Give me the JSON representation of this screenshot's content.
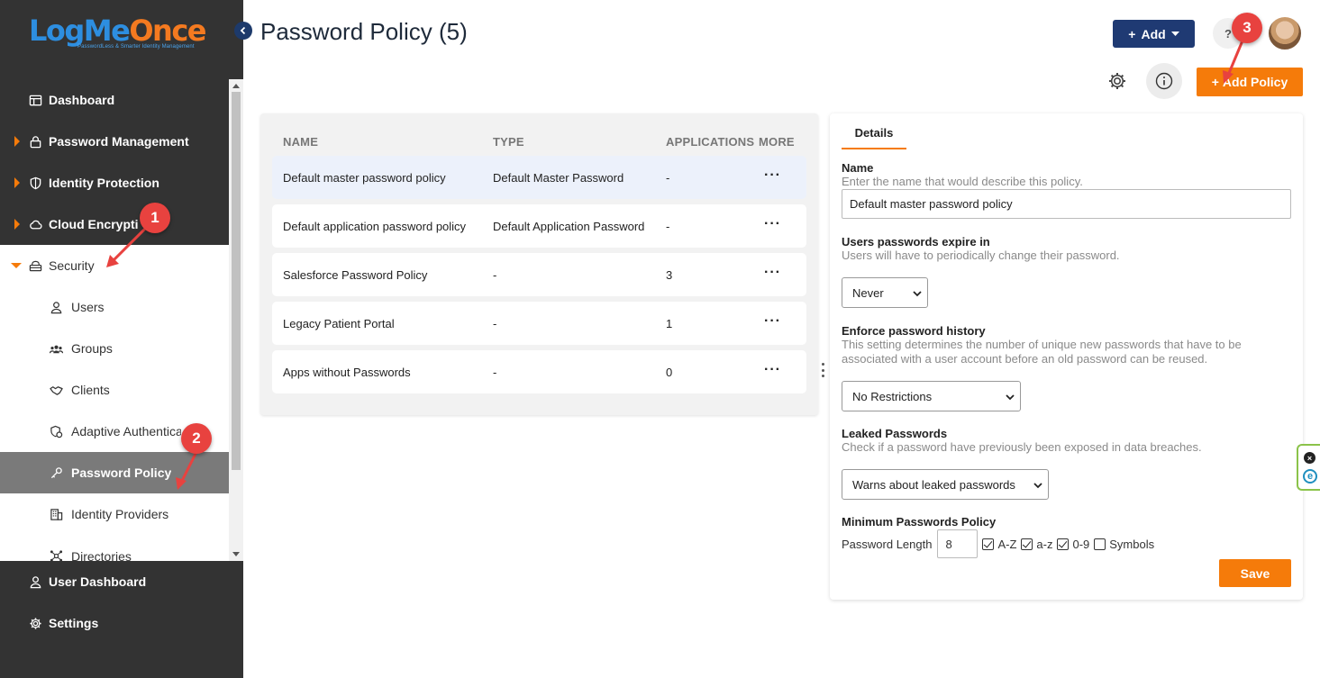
{
  "logo": {
    "brand_part1": "LogMe",
    "brand_part2": "Once",
    "tagline": "PasswordLess & Smarter Identity Management"
  },
  "sidebar": {
    "items": [
      {
        "label": "Dashboard",
        "icon": "dashboard-icon"
      },
      {
        "label": "Password Management",
        "icon": "lock-icon"
      },
      {
        "label": "Identity Protection",
        "icon": "shield-icon"
      },
      {
        "label": "Cloud Encryption",
        "icon": "cloud-icon"
      },
      {
        "label": "Security",
        "icon": "security-icon"
      }
    ],
    "security_children": [
      {
        "label": "Users",
        "icon": "user-icon"
      },
      {
        "label": "Groups",
        "icon": "groups-icon"
      },
      {
        "label": "Clients",
        "icon": "handshake-icon"
      },
      {
        "label": "Adaptive Authentication",
        "icon": "adaptive-auth-icon"
      },
      {
        "label": "Password Policy",
        "icon": "key-icon"
      },
      {
        "label": "Identity Providers",
        "icon": "building-icon"
      },
      {
        "label": "Directories",
        "icon": "directories-icon"
      }
    ],
    "bottom": [
      {
        "label": "User Dashboard",
        "icon": "user-icon"
      },
      {
        "label": "Settings",
        "icon": "gear-icon"
      }
    ]
  },
  "markers": {
    "m1": "1",
    "m2": "2",
    "m3": "3"
  },
  "header": {
    "title": "Password Policy (5)",
    "add_label": "Add",
    "help": "?",
    "add_policy_label": "Add Policy"
  },
  "table": {
    "columns": [
      "NAME",
      "TYPE",
      "APPLICATIONS",
      "MORE"
    ],
    "rows": [
      {
        "name": "Default master password policy",
        "type": "Default Master Password",
        "apps": "-",
        "more": "···"
      },
      {
        "name": "Default application password policy",
        "type": "Default Application Password",
        "apps": "-",
        "more": "···"
      },
      {
        "name": "Salesforce Password Policy",
        "type": "-",
        "apps": "3",
        "more": "···"
      },
      {
        "name": "Legacy Patient Portal",
        "type": "-",
        "apps": "1",
        "more": "···"
      },
      {
        "name": "Apps without Passwords",
        "type": "-",
        "apps": "0",
        "more": "···"
      }
    ]
  },
  "details": {
    "tab": "Details",
    "name_label": "Name",
    "name_help": "Enter the name that would describe this policy.",
    "name_value": "Default master password policy",
    "expire_label": "Users passwords expire in",
    "expire_help": "Users will have to periodically change their password.",
    "expire_value": "Never",
    "history_label": "Enforce password history",
    "history_help": "This setting determines the number of unique new passwords that have to be associated with a user account before an old password can be reused.",
    "history_value": "No Restrictions",
    "leaked_label": "Leaked Passwords",
    "leaked_help": "Check if a password have previously been exposed in data breaches.",
    "leaked_value": "Warns about leaked passwords",
    "min_label": "Minimum Passwords Policy",
    "length_label": "Password Length",
    "length_value": "8",
    "cb_upper": "A-Z",
    "cb_lower": "a-z",
    "cb_digits": "0-9",
    "cb_symbols": "Symbols",
    "save_label": "Save"
  },
  "colors": {
    "accent": "#f57b0a",
    "primary": "#1f3a73",
    "sidebar": "#333333",
    "marker": "#e8423f"
  }
}
